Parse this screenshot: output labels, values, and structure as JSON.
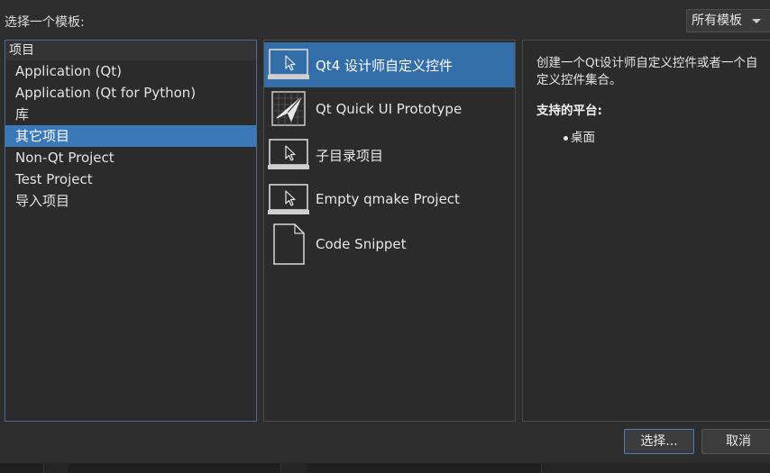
{
  "dialog": {
    "choose_template_label": "选择一个模板:",
    "filter": {
      "selected": "所有模板"
    }
  },
  "categories": {
    "header": "项目",
    "items": [
      {
        "label": "Application (Qt)",
        "selected": false
      },
      {
        "label": "Application (Qt for Python)",
        "selected": false
      },
      {
        "label": "库",
        "selected": false
      },
      {
        "label": "其它项目",
        "selected": true
      },
      {
        "label": "Non-Qt Project",
        "selected": false
      },
      {
        "label": "Test Project",
        "selected": false
      },
      {
        "label": "导入项目",
        "selected": false
      }
    ]
  },
  "templates": {
    "items": [
      {
        "label": "Qt4 设计师自定义控件",
        "icon": "monitor-cursor-icon",
        "selected": true
      },
      {
        "label": "Qt Quick UI Prototype",
        "icon": "paper-plane-icon",
        "selected": false
      },
      {
        "label": "子目录项目",
        "icon": "monitor-cursor-icon",
        "selected": false
      },
      {
        "label": "Empty qmake Project",
        "icon": "monitor-cursor-icon",
        "selected": false
      },
      {
        "label": "Code Snippet",
        "icon": "document-icon",
        "selected": false
      }
    ]
  },
  "description": {
    "text": "创建一个Qt设计师自定义控件或者一个自定义控件集合。",
    "platforms_title": "支持的平台:",
    "platforms": [
      "桌面"
    ]
  },
  "buttons": {
    "choose": "选择...",
    "cancel": "取消"
  },
  "colors": {
    "background": "#2d2d2d",
    "selection": "#3b78b8",
    "panel": "#2b2b2b"
  }
}
